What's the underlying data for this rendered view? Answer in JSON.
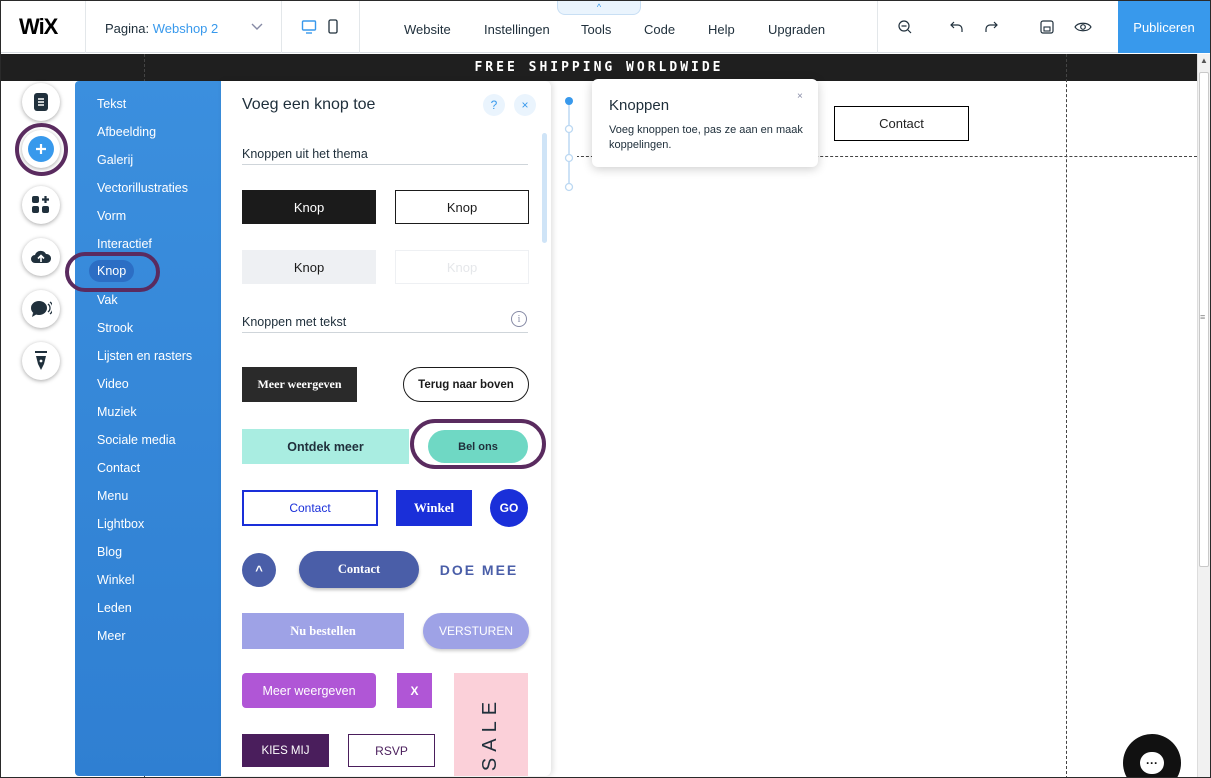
{
  "topbar": {
    "logo": "WiX",
    "page_label": "Pagina:",
    "page_name": "Webshop 2",
    "menu": [
      "Website",
      "Instellingen",
      "Tools",
      "Code",
      "Help",
      "Upgraden"
    ],
    "publish_label": "Publiceren"
  },
  "canvas": {
    "strip_text": "FREE SHIPPING WORLDWIDE",
    "contact_button": "Contact"
  },
  "categories": [
    "Tekst",
    "Afbeelding",
    "Galerij",
    "Vectorillustraties",
    "Vorm",
    "Interactief",
    "Knop",
    "Vak",
    "Strook",
    "Lijsten en rasters",
    "Video",
    "Muziek",
    "Sociale media",
    "Contact",
    "Menu",
    "Lightbox",
    "Blog",
    "Winkel",
    "Leden",
    "Meer"
  ],
  "selected_category": "Knop",
  "panel": {
    "title": "Voeg een knop toe",
    "help": "?",
    "close": "×",
    "section_theme": "Knoppen uit het thema",
    "section_text": "Knoppen met tekst",
    "info": "i",
    "theme_buttons": [
      "Knop",
      "Knop",
      "Knop",
      "Knop"
    ],
    "text_buttons": {
      "meer_weergeven": "Meer weergeven",
      "terug": "Terug naar boven",
      "ontdek": "Ontdek meer",
      "bel_ons": "Bel ons",
      "contact": "Contact",
      "winkel": "Winkel",
      "go": "GO",
      "caret": "^",
      "contact2": "Contact",
      "doe_mee": "DOE MEE",
      "nu_bestellen": "Nu bestellen",
      "versturen": "VERSTUREN",
      "meer_weergeven2": "Meer weergeven",
      "x": "X",
      "sale": "SALE",
      "kies_mij": "KIES MIJ",
      "rsvp": "RSVP"
    }
  },
  "tooltip": {
    "title": "Knoppen",
    "text": "Voeg knoppen toe, pas ze aan en maak koppelingen.",
    "close": "×"
  },
  "colors": {
    "accent": "#3899ec",
    "panel_blue": "#3b8fde",
    "annotation_ring": "#5a2b5f",
    "teal": "#6fd8c4",
    "mint": "#a9ede1",
    "navy": "#1a2fd9",
    "slate": "#4a5ea8",
    "lavender": "#9ea2e6",
    "purple": "#b056d6",
    "dark_purple": "#4a1e5c",
    "pink": "#fbd0d9"
  }
}
